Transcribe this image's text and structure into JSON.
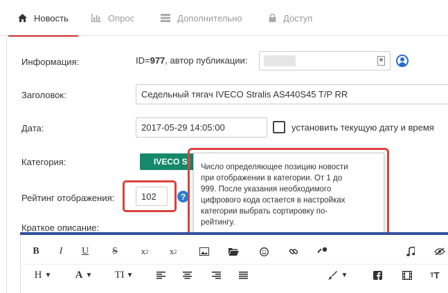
{
  "tabs": [
    {
      "label": "Новость",
      "icon": "home-icon",
      "active": true
    },
    {
      "label": "Опрос",
      "icon": "bar-chart-icon",
      "active": false
    },
    {
      "label": "Дополнительно",
      "icon": "server-icon",
      "active": false
    },
    {
      "label": "Доступ",
      "icon": "lock-icon",
      "active": false
    }
  ],
  "form": {
    "info_label": "Информация:",
    "id_prefix": "ID=",
    "id_value": "977",
    "author_label": ", автор публикации:",
    "title_label": "Заголовок:",
    "title_value": "Седельный тягач IVECO Stralis AS440S45 T/P RR",
    "date_label": "Дата:",
    "date_value": "2017-05-29 14:05:00",
    "set_current_date_label": "установить текущую дату и время",
    "category_label": "Категория:",
    "category_value": "IVECO St",
    "rating_label": "Рейтинг отображения:",
    "rating_value": "102",
    "help_symbol": "?",
    "short_desc_label": "Краткое описание:"
  },
  "tooltip": {
    "text": "Число определяющее позицию новости\nпри отображении в категории. От 1 до\n999. После указания необходимого\nцифрового кода остается в настройках\nкатегории выбрать сортировку по-\nрейтингу."
  },
  "editor": {
    "row1": [
      "bold-icon",
      "italic-icon",
      "underline-icon",
      "strikethrough-icon",
      "subscript-icon",
      "superscript-icon",
      "image-icon",
      "folder-icon",
      "emoji-icon",
      "link-icon",
      "key-icon",
      "music-icon",
      "hide-icon"
    ],
    "row2": [
      "heading-icon",
      "font-color-icon",
      "font-size-icon",
      "align-left-icon",
      "align-center-icon",
      "align-right-icon",
      "align-justify-icon",
      "paint-icon",
      "facebook-icon",
      "video-icon",
      "typography-icon"
    ]
  },
  "colors": {
    "accent_red": "#d9413d",
    "category_green": "#16886b",
    "help_blue": "#2a7dd4",
    "editor_bar": "#3450a0"
  }
}
